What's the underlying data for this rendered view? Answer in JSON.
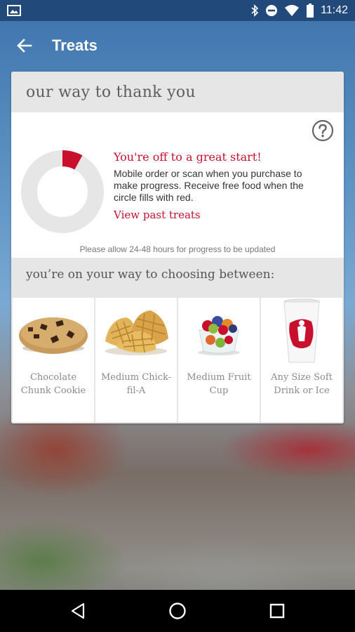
{
  "status_bar": {
    "time": "11:42",
    "icons": [
      "image-icon",
      "bluetooth-icon",
      "do-not-disturb-icon",
      "wifi-icon",
      "battery-icon"
    ]
  },
  "app_bar": {
    "title": "Treats",
    "back_icon": "arrow-back-icon"
  },
  "card": {
    "header_title": "our way to thank you",
    "help_icon": "help-circle-icon",
    "progress": {
      "fraction": 0.08,
      "fill_color": "#c8102e",
      "track_color": "#e6e6e6",
      "headline": "You're off to a great start!",
      "description": "Mobile order or scan when you purchase to make progress. Receive free food when the circle fills with red.",
      "link_label": "View past treats"
    },
    "note": "Please allow 24-48 hours for progress to be updated",
    "choose_title": "you’re on your way to choosing between:",
    "items": [
      {
        "label": "Chocolate Chunk Cookie"
      },
      {
        "label": "Medium Chick-fil-A"
      },
      {
        "label": "Medium Fruit Cup"
      },
      {
        "label": "Any Size Soft Drink or Ice"
      }
    ]
  },
  "nav_bar": {
    "icons": [
      "back-triangle-icon",
      "home-circle-icon",
      "recents-square-icon"
    ]
  },
  "colors": {
    "brand_red": "#c8102e",
    "app_bar_blue": "#214a7a"
  }
}
